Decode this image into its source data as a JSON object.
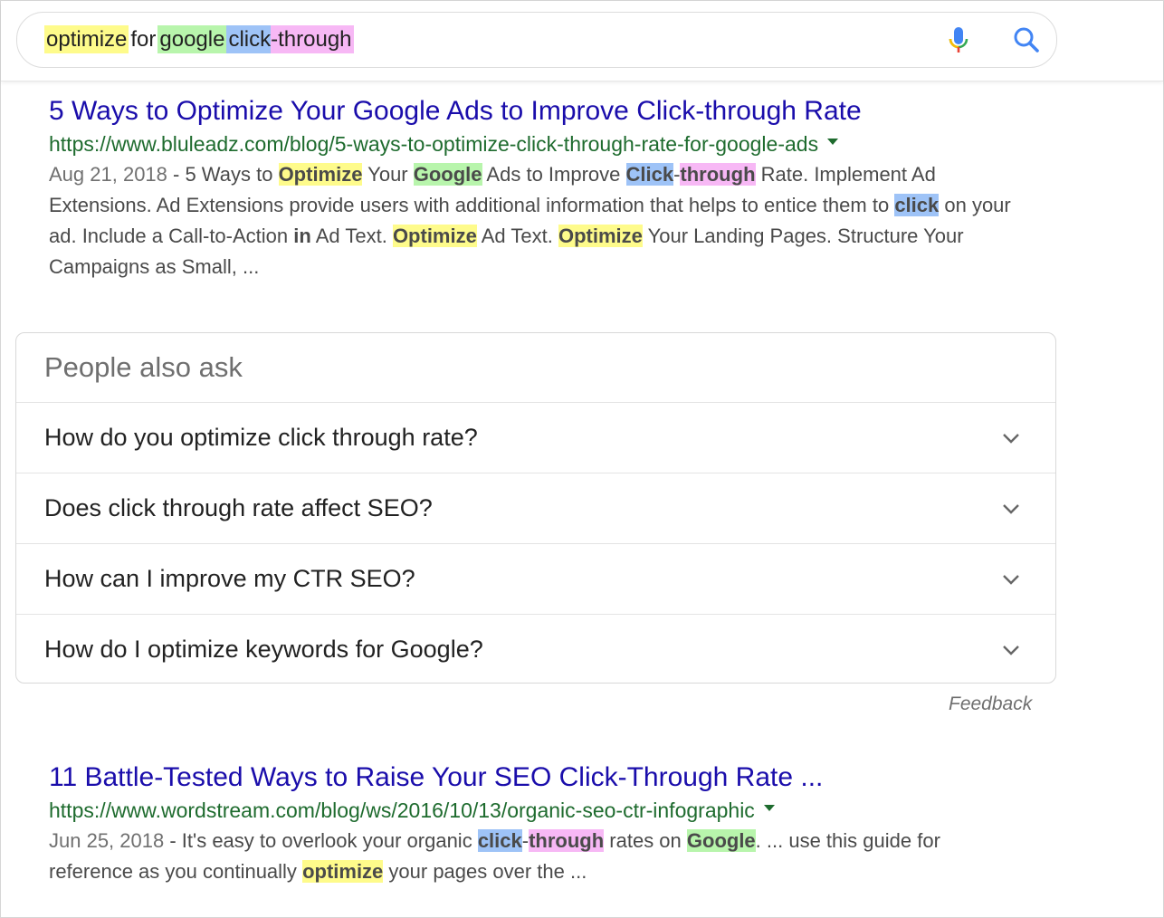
{
  "search": {
    "query_terms": [
      "optimize",
      "for",
      "google",
      "click",
      "-through"
    ],
    "mic_icon": "microphone-icon",
    "search_icon": "magnifier-icon"
  },
  "results": [
    {
      "title": "5 Ways to Optimize Your Google Ads to Improve Click-through Rate",
      "url": "https://www.bluleadz.com/blog/5-ways-to-optimize-click-through-rate-for-google-ads",
      "date": "Aug 21, 2018",
      "snippet_parts": {
        "p1": " - 5 Ways to ",
        "p2": "Optimize",
        "p3": " Your ",
        "p4": "Google",
        "p5": " Ads to Improve ",
        "p6": "Click",
        "p7": "-",
        "p8": "through",
        "p9": " Rate. Implement Ad Extensions. Ad Extensions provide users with additional information that helps to entice them to ",
        "p10": "click",
        "p11": " on your ad. Include a Call-to-Action ",
        "p12": "in",
        "p13": " Ad Text. ",
        "p14": "Optimize",
        "p15": " Ad Text. ",
        "p16": "Optimize",
        "p17": " Your Landing Pages. Structure Your Campaigns as Small, ..."
      }
    },
    {
      "title": "11 Battle-Tested Ways to Raise Your SEO Click-Through Rate ...",
      "url": "https://www.wordstream.com/blog/ws/2016/10/13/organic-seo-ctr-infographic",
      "date": "Jun 25, 2018",
      "snippet_parts": {
        "p1": " - It's easy to overlook your organic ",
        "p2": "click",
        "p3": "-",
        "p4": "through",
        "p5": " rates on ",
        "p6": "Google",
        "p7": ". ... use this guide for reference as you continually ",
        "p8": "optimize",
        "p9": " your pages over the ..."
      }
    }
  ],
  "people_also_ask": {
    "title": "People also ask",
    "questions": [
      "How do you optimize click through rate?",
      "Does click through rate affect SEO?",
      "How can I improve my CTR SEO?",
      "How do I optimize keywords for Google?"
    ],
    "expand_icon": "chevron-down-icon"
  },
  "feedback_label": "Feedback",
  "colors": {
    "highlight_yellow": "#fefb8b",
    "highlight_green": "#b8f5ac",
    "highlight_blue": "#9ec3f7",
    "highlight_pink": "#f7b8f5",
    "link_title": "#1a0dab",
    "url_green": "#1e6b2e"
  }
}
